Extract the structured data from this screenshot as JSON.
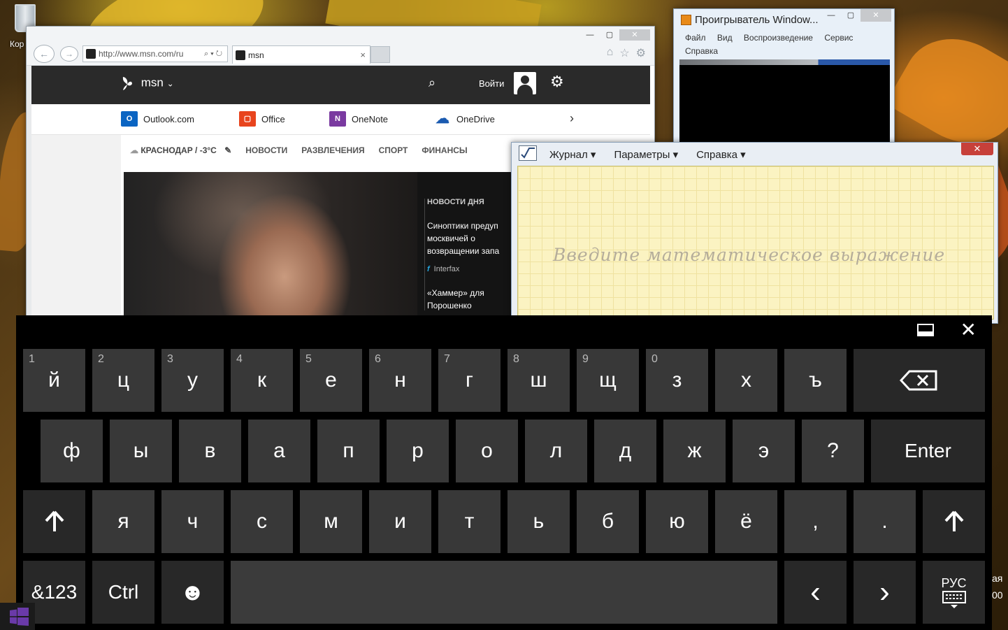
{
  "desktop": {
    "recycle_bin_label": "Кор"
  },
  "ie": {
    "address": "http://www.msn.com/ru",
    "tab_title": "msn",
    "tab_close": "×",
    "window_controls": {
      "minimize": "—",
      "maximize": "▢",
      "close": "✕"
    },
    "msn": {
      "logo": "msn",
      "sign_in": "Войти",
      "apps": [
        "Outlook.com",
        "Office",
        "OneNote",
        "OneDrive"
      ],
      "nav": {
        "city": "КРАСНОДАР / -3°C",
        "items": [
          "НОВОСТИ",
          "РАЗВЛЕЧЕНИЯ",
          "СПОРТ",
          "ФИНАНСЫ"
        ]
      },
      "news": {
        "heading": "НОВОСТИ ДНЯ",
        "item1_lines": [
          "Синоптики предуп",
          "москвичей о",
          "возвращении запа"
        ],
        "item1_source": "Interfax",
        "item2_lines": [
          "«Хаммер» для",
          "Порошенко"
        ]
      }
    }
  },
  "wmp": {
    "title": "Проигрыватель Window...",
    "menu": [
      "Файл",
      "Вид",
      "Воспроизведение",
      "Сервис",
      "Справка"
    ]
  },
  "math_panel": {
    "menu": [
      "Журнал ▾",
      "Параметры ▾",
      "Справка ▾"
    ],
    "hint": "Введите математическое выражение",
    "close": "✕"
  },
  "keyboard": {
    "row1": [
      {
        "num": "1",
        "ch": "й"
      },
      {
        "num": "2",
        "ch": "ц"
      },
      {
        "num": "3",
        "ch": "у"
      },
      {
        "num": "4",
        "ch": "к"
      },
      {
        "num": "5",
        "ch": "е"
      },
      {
        "num": "6",
        "ch": "н"
      },
      {
        "num": "7",
        "ch": "г"
      },
      {
        "num": "8",
        "ch": "ш"
      },
      {
        "num": "9",
        "ch": "щ"
      },
      {
        "num": "0",
        "ch": "з"
      },
      {
        "num": "",
        "ch": "х"
      },
      {
        "num": "",
        "ch": "ъ"
      }
    ],
    "backspace": "⌫",
    "row2": [
      "ф",
      "ы",
      "в",
      "а",
      "п",
      "р",
      "о",
      "л",
      "д",
      "ж",
      "э",
      "?"
    ],
    "enter": "Enter",
    "shift": "🡅",
    "row3": [
      "я",
      "ч",
      "с",
      "м",
      "и",
      "т",
      "ь",
      "б",
      "ю",
      "ё",
      ",",
      "."
    ],
    "row4": {
      "symbols": "&123",
      "ctrl": "Ctrl",
      "emoji": "☻",
      "left": "‹",
      "right": "›",
      "lang": "РУС"
    }
  },
  "tray": {
    "text1": "ая",
    "text2": "00"
  }
}
